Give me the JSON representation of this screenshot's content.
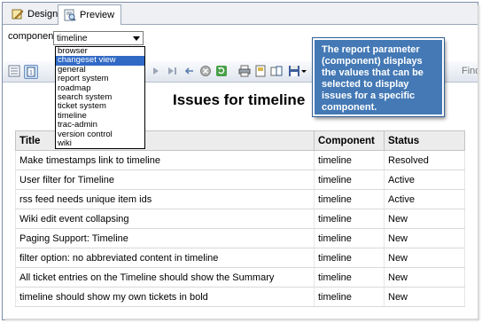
{
  "tabs": [
    {
      "label": "Design",
      "icon": "design-icon"
    },
    {
      "label": "Preview",
      "icon": "preview-icon"
    }
  ],
  "parameter": {
    "label": "component",
    "selected": "timeline",
    "options": [
      "browser",
      "changeset view",
      "general",
      "report system",
      "roadmap",
      "search system",
      "ticket system",
      "timeline",
      "trac-admin",
      "version control",
      "wiki"
    ],
    "highlighted_option": "changeset view"
  },
  "toolbar": {
    "find_label": "Find"
  },
  "report": {
    "title": "Issues for timeline",
    "columns": [
      "Title",
      "Component",
      "Status"
    ],
    "rows": [
      [
        "Make timestamps link to timeline",
        "timeline",
        "Resolved"
      ],
      [
        "User filter for Timeline",
        "timeline",
        "Active"
      ],
      [
        "rss feed needs unique item ids",
        "timeline",
        "Active"
      ],
      [
        "Wiki edit event collapsing",
        "timeline",
        "New"
      ],
      [
        "Paging Support: Timeline",
        "timeline",
        "New"
      ],
      [
        "filter option: no abbreviated content in timeline",
        "timeline",
        "New"
      ],
      [
        "All ticket entries on the Timeline should show the Summary",
        "timeline",
        "New"
      ],
      [
        "timeline should show my own tickets in bold",
        "timeline",
        "New"
      ]
    ]
  },
  "callout": {
    "text": "The report parameter (component) displays the values that can be selected to display issues for a specific component."
  },
  "colors": {
    "callout_bg": "#4479b5",
    "selection": "#316ac5",
    "header_bg": "#ececec"
  }
}
